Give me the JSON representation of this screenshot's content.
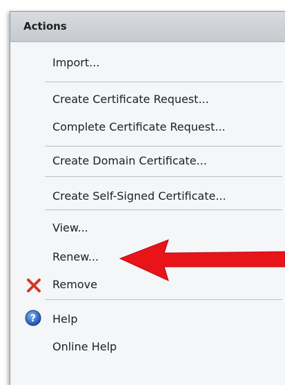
{
  "panel": {
    "title": "Actions"
  },
  "items": [
    {
      "label": "Import..."
    },
    {
      "label": "Create Certificate Request..."
    },
    {
      "label": "Complete Certificate Request..."
    },
    {
      "label": "Create Domain Certificate..."
    },
    {
      "label": "Create Self-Signed Certificate..."
    },
    {
      "label": "View..."
    },
    {
      "label": "Renew..."
    },
    {
      "label": "Remove",
      "icon": "red-x-icon"
    },
    {
      "label": "Help",
      "icon": "blue-help-icon"
    },
    {
      "label": "Online Help"
    }
  ],
  "annotation": {
    "icon": "red-arrow-icon",
    "color": "#e8141a"
  }
}
